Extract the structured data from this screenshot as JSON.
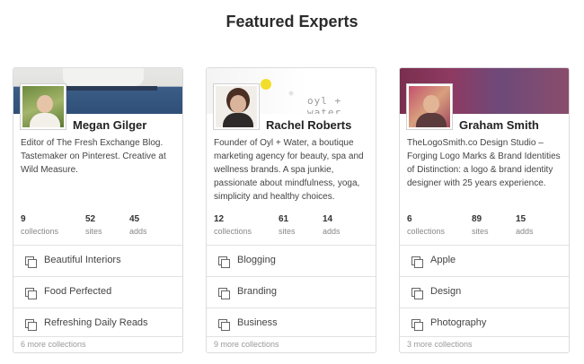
{
  "page_title": "Featured Experts",
  "banner_brand_text": "oyl + water",
  "experts": [
    {
      "name": "Megan Gilger",
      "bio": "Editor of The Fresh Exchange Blog. Tastemaker on Pinterest. Creative at Wild Measure.",
      "stats": [
        {
          "value": "9",
          "label": "collections"
        },
        {
          "value": "52",
          "label": "sites"
        },
        {
          "value": "45",
          "label": "adds"
        }
      ],
      "collections": [
        "Beautiful Interiors",
        "Food Perfected",
        "Refreshing Daily Reads"
      ],
      "more": "6 more collections"
    },
    {
      "name": "Rachel Roberts",
      "bio": "Founder of Oyl + Water, a boutique marketing agency for beauty, spa and wellness brands. A spa junkie, passionate about mindfulness, yoga, simplicity and healthy choices.",
      "stats": [
        {
          "value": "12",
          "label": "collections"
        },
        {
          "value": "61",
          "label": "sites"
        },
        {
          "value": "14",
          "label": "adds"
        }
      ],
      "collections": [
        "Blogging",
        "Branding",
        "Business"
      ],
      "more": "9 more collections"
    },
    {
      "name": "Graham Smith",
      "bio": "TheLogoSmith.co Design Studio – Forging Logo Marks & Brand Identities of Distinction: a logo & brand identity designer with 25 years experience.",
      "stats": [
        {
          "value": "6",
          "label": "collections"
        },
        {
          "value": "89",
          "label": "sites"
        },
        {
          "value": "15",
          "label": "adds"
        }
      ],
      "collections": [
        "Apple",
        "Design",
        "Photography"
      ],
      "more": "3 more collections"
    }
  ]
}
